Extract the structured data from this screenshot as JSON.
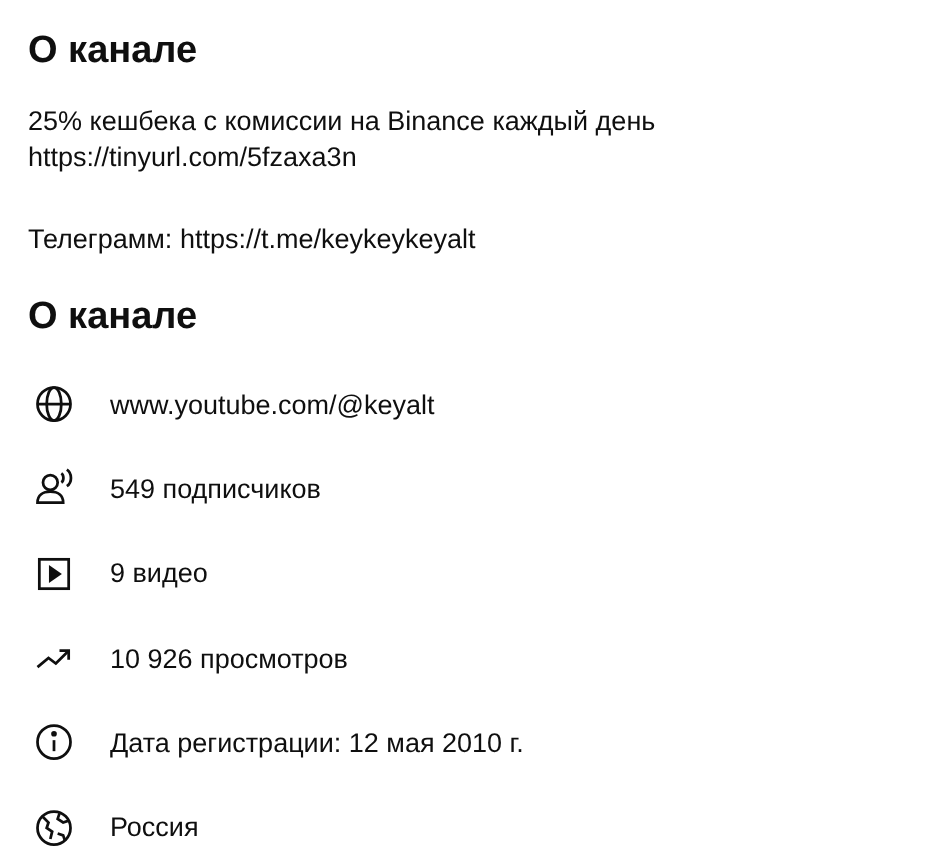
{
  "about_heading": "О канале",
  "description": [
    {
      "lines": [
        "25% кешбека с комиссии на Binance каждый день",
        "https://tinyurl.com/5fzaxa3n"
      ]
    },
    {
      "lines": [
        "Телеграмм: https://t.me/keykeykeyalt"
      ]
    }
  ],
  "details_heading": "О канале",
  "details": [
    {
      "kind": "link",
      "text": "www.youtube.com/@keyalt"
    },
    {
      "kind": "subscribers",
      "text": "549 подписчиков"
    },
    {
      "kind": "videos",
      "text": "9 видео"
    },
    {
      "kind": "views",
      "text": "10 926 просмотров"
    },
    {
      "kind": "joined",
      "text": "Дата регистрации: 12 мая 2010 г."
    },
    {
      "kind": "country",
      "text": "Россия"
    }
  ]
}
